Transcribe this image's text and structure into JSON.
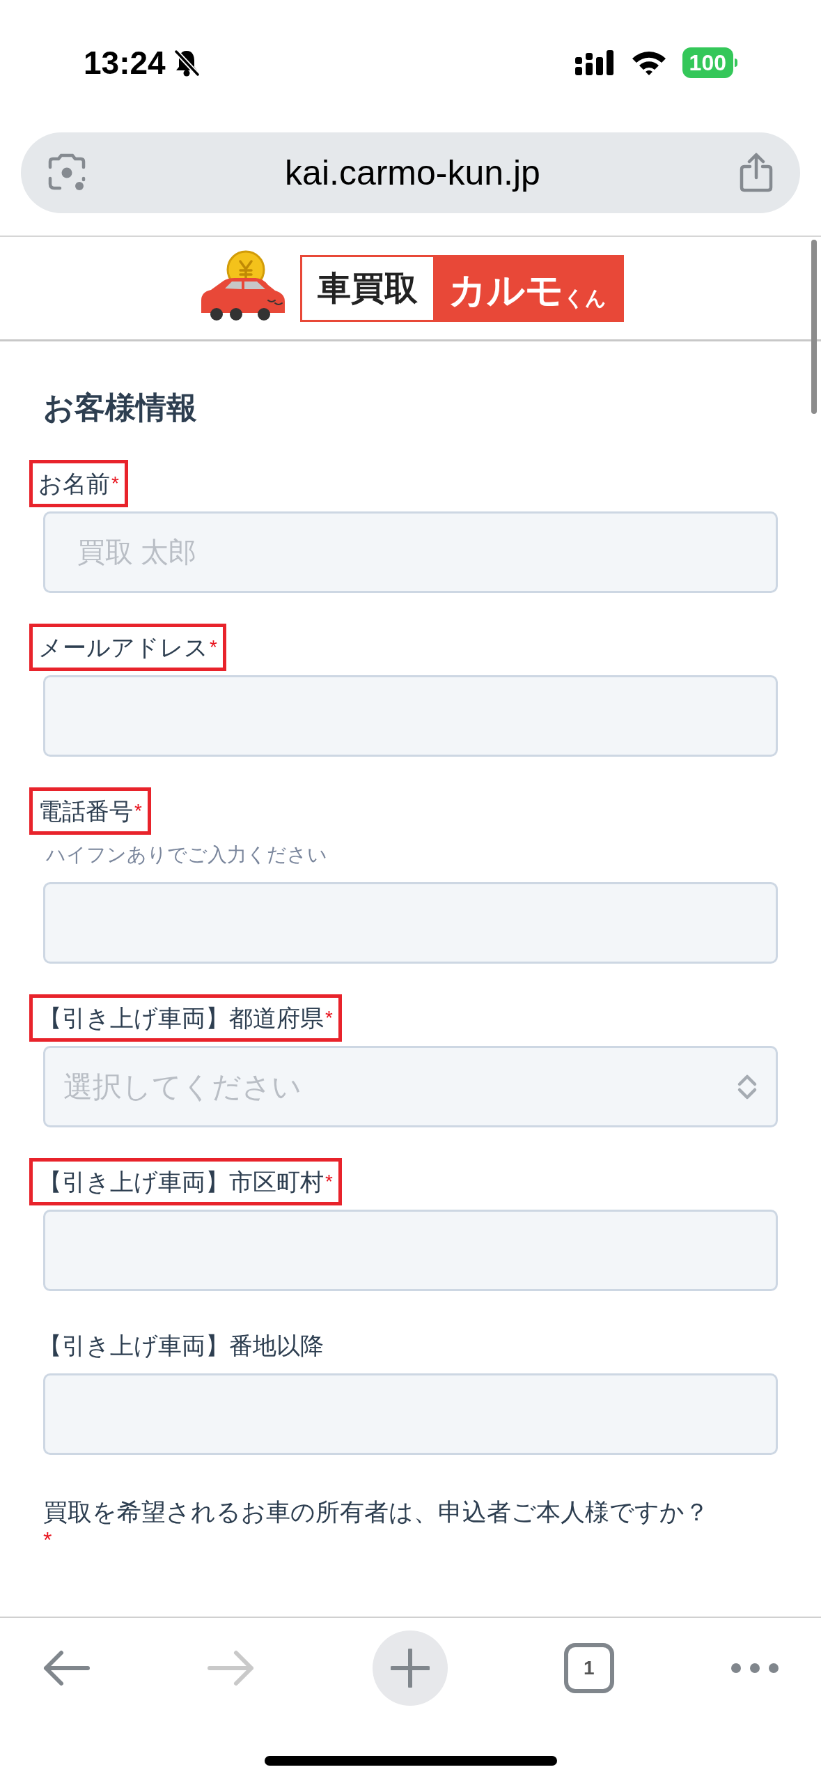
{
  "status_bar": {
    "time": "13:24",
    "silent": true,
    "battery": "100"
  },
  "browser": {
    "url": "kai.carmo-kun.jp"
  },
  "logo": {
    "left": "車買取",
    "right": "カルモ",
    "small": "くん"
  },
  "section_title": "お客様情報",
  "required_mark": "*",
  "fields": [
    {
      "kind": "input",
      "label": "お名前",
      "required": true,
      "highlighted": true,
      "placeholder": "買取 太郎"
    },
    {
      "kind": "input",
      "label": "メールアドレス",
      "required": true,
      "highlighted": true
    },
    {
      "kind": "input",
      "label": "電話番号",
      "required": true,
      "highlighted": true,
      "hint": "ハイフンありでご入力ください"
    },
    {
      "kind": "select",
      "label": "【引き上げ車両】都道府県",
      "required": true,
      "highlighted": true,
      "placeholder": "選択してください"
    },
    {
      "kind": "input",
      "label": "【引き上げ車両】市区町村",
      "required": true,
      "highlighted": true
    },
    {
      "kind": "input",
      "label": "【引き上げ車両】番地以降",
      "required": false,
      "highlighted": false
    }
  ],
  "question": {
    "text": "買取を希望されるお車の所有者は、申込者ご本人様ですか？",
    "required": true
  },
  "toolbar": {
    "forward_disabled": true,
    "tab_count": "1"
  }
}
